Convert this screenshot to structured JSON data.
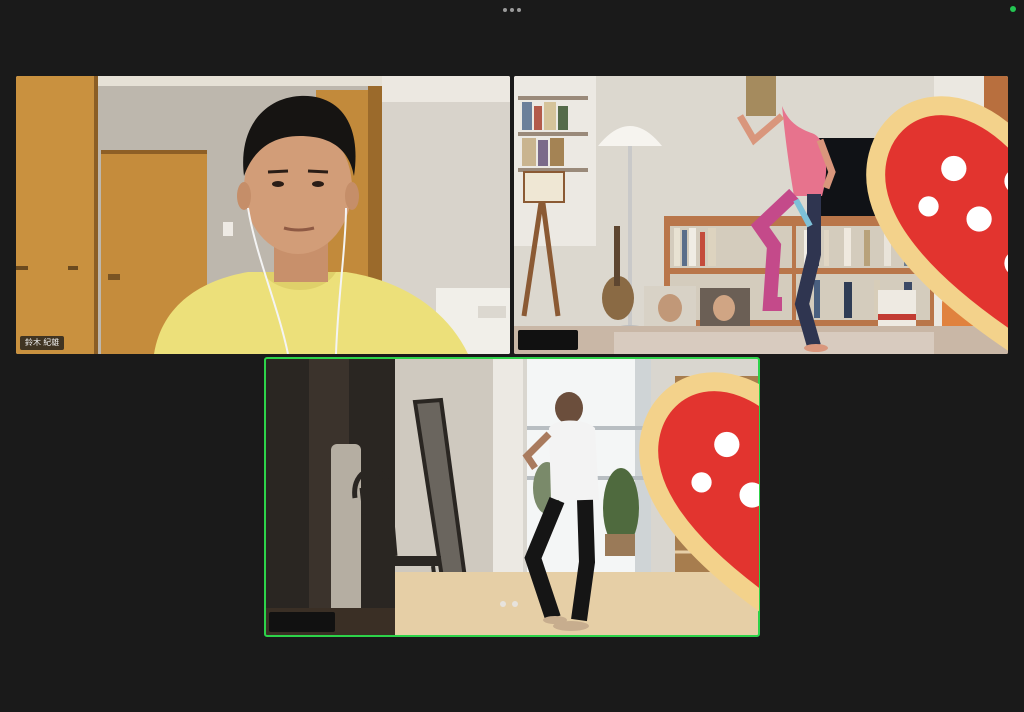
{
  "window": {
    "menu_icon": "more-dots-icon",
    "status_color": "#23c552"
  },
  "participants": [
    {
      "name": "鈴木 紀雄",
      "speaking": false
    },
    {
      "name": "",
      "speaking": false
    },
    {
      "name": "",
      "speaking": true
    }
  ],
  "active_speaker_color": "#2dd34a",
  "pagination": {
    "pages": 2
  }
}
